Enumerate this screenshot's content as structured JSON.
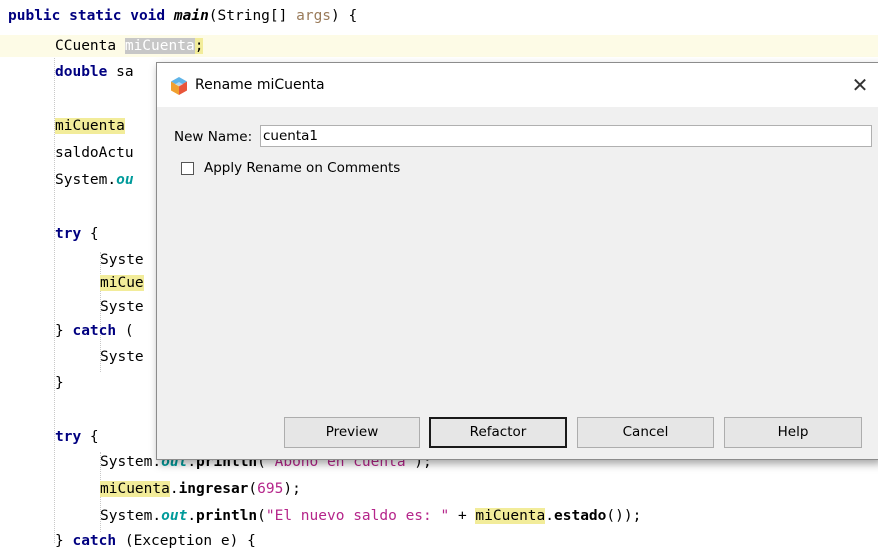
{
  "code": {
    "line1": {
      "kw1": "public static void ",
      "method": "main",
      "rest": "(String[] ",
      "param": "args",
      "end": ") {"
    },
    "line2": {
      "type": "CCuenta ",
      "var": "miCuenta",
      "end": ";"
    },
    "line3": {
      "kw": "double",
      "rest": " sa"
    },
    "line5": {
      "var": "miCuenta"
    },
    "line6": {
      "text": "saldoActu"
    },
    "line7": {
      "text": "System.",
      "field": "ou"
    },
    "line9": {
      "kw": "try",
      "rest": " {"
    },
    "line10": {
      "text": "Syste"
    },
    "line11": {
      "var": "miCue"
    },
    "line12": {
      "text": "Syste"
    },
    "line13": {
      "pre": "} ",
      "kw": "catch",
      "rest": " ("
    },
    "line14": {
      "text": "Syste"
    },
    "line15": {
      "text": "}"
    },
    "line17": {
      "kw": "try",
      "rest": " {"
    },
    "line18": {
      "pre": "System.",
      "field": "out",
      "dot": ".",
      "meth": "println",
      "open": "(",
      "str": "\"Abono en cuenta\"",
      "end": ");"
    },
    "line19": {
      "var": "miCuenta",
      "dot": ".",
      "meth": "ingresar",
      "open": "(",
      "num": "695",
      "end": ");"
    },
    "line20": {
      "pre": "System.",
      "field": "out",
      "dot": ".",
      "meth": "println",
      "open": "(",
      "str": "\"El nuevo saldo es: \"",
      "plus": " + ",
      "var": "miCuenta",
      "dot2": ".",
      "meth2": "estado",
      "end": "());"
    },
    "line21": {
      "pre": "} ",
      "kw": "catch",
      "rest": " (Exception e) {"
    }
  },
  "dialog": {
    "title": "Rename  miCuenta",
    "close_glyph": "✕",
    "app_icon": "netbeans-cube-icon",
    "new_name_label": "New Name:",
    "new_name_value": "cuenta1",
    "apply_checkbox_label": "Apply Rename on Comments",
    "apply_checked": false,
    "buttons": {
      "preview": "Preview",
      "refactor": "Refactor",
      "cancel": "Cancel",
      "help": "Help"
    }
  },
  "colors": {
    "keyword": "#000080",
    "string": "#b5258a",
    "field": "#009b9b",
    "occurrence_highlight": "#f2ec9a"
  }
}
